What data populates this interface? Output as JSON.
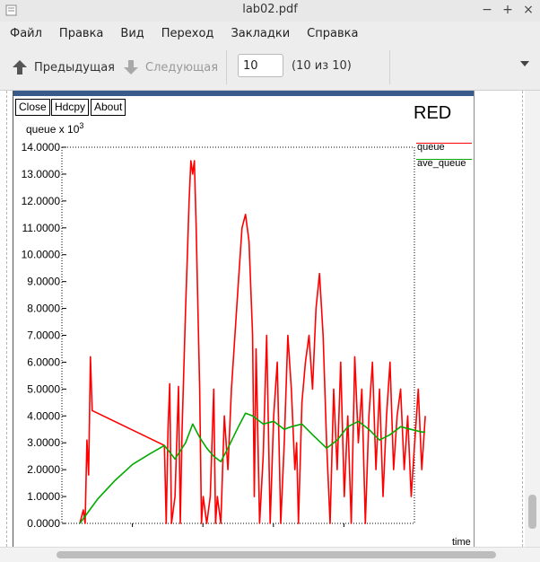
{
  "window": {
    "title": "lab02.pdf",
    "controls": [
      "−",
      "+",
      "×"
    ]
  },
  "menu": [
    "Файл",
    "Правка",
    "Вид",
    "Переход",
    "Закладки",
    "Справка"
  ],
  "toolbar": {
    "prev_label": "Предыдущая",
    "next_label": "Следующая",
    "page_value": "10",
    "page_count": "(10 из 10)"
  },
  "xgraph": {
    "buttons": [
      "Close",
      "Hdcpy",
      "About"
    ],
    "title": "RED",
    "ylabel_base": "queue x 10",
    "ylabel_exp": "3",
    "xlabel": "time",
    "legend": [
      "queue",
      "ave_queue"
    ],
    "colors": {
      "queue": "#ff0000",
      "ave_queue": "#00aa00"
    }
  },
  "chart_data": {
    "type": "line",
    "title": "RED",
    "ylabel": "queue x 10^3",
    "xlabel": "time",
    "ylim": [
      0,
      14
    ],
    "yticks": [
      "0.0000",
      "1.0000",
      "2.0000",
      "3.0000",
      "4.0000",
      "5.0000",
      "6.0000",
      "7.0000",
      "8.0000",
      "9.0000",
      "10.0000",
      "11.0000",
      "12.0000",
      "13.0000",
      "14.0000"
    ],
    "grid": false,
    "legend_position": "right",
    "series": [
      {
        "name": "queue",
        "points": [
          [
            0.0,
            0.0
          ],
          [
            0.01,
            0.5
          ],
          [
            0.015,
            0.0
          ],
          [
            0.02,
            3.1
          ],
          [
            0.025,
            1.8
          ],
          [
            0.03,
            6.2
          ],
          [
            0.035,
            4.2
          ],
          [
            0.24,
            2.9
          ],
          [
            0.245,
            0.0
          ],
          [
            0.25,
            3.5
          ],
          [
            0.255,
            5.2
          ],
          [
            0.26,
            0.0
          ],
          [
            0.27,
            1.0
          ],
          [
            0.28,
            5.1
          ],
          [
            0.285,
            0.0
          ],
          [
            0.29,
            3.5
          ],
          [
            0.3,
            8.0
          ],
          [
            0.305,
            10.0
          ],
          [
            0.31,
            12.0
          ],
          [
            0.315,
            13.5
          ],
          [
            0.32,
            13.0
          ],
          [
            0.325,
            13.5
          ],
          [
            0.33,
            11.0
          ],
          [
            0.34,
            5.0
          ],
          [
            0.345,
            0.0
          ],
          [
            0.35,
            1.0
          ],
          [
            0.36,
            0.0
          ],
          [
            0.37,
            1.0
          ],
          [
            0.38,
            5.0
          ],
          [
            0.385,
            0.0
          ],
          [
            0.39,
            1.0
          ],
          [
            0.4,
            0.0
          ],
          [
            0.41,
            4.0
          ],
          [
            0.42,
            2.0
          ],
          [
            0.43,
            5.0
          ],
          [
            0.44,
            7.0
          ],
          [
            0.45,
            9.0
          ],
          [
            0.46,
            11.0
          ],
          [
            0.47,
            11.5
          ],
          [
            0.48,
            10.5
          ],
          [
            0.49,
            7.0
          ],
          [
            0.495,
            1.0
          ],
          [
            0.5,
            6.5
          ],
          [
            0.51,
            0.0
          ],
          [
            0.52,
            2.5
          ],
          [
            0.53,
            7.0
          ],
          [
            0.54,
            0.0
          ],
          [
            0.55,
            4.0
          ],
          [
            0.56,
            6.0
          ],
          [
            0.57,
            0.0
          ],
          [
            0.58,
            3.0
          ],
          [
            0.59,
            7.0
          ],
          [
            0.6,
            5.0
          ],
          [
            0.61,
            2.0
          ],
          [
            0.615,
            3.0
          ],
          [
            0.62,
            0.0
          ],
          [
            0.63,
            4.5
          ],
          [
            0.64,
            6.0
          ],
          [
            0.65,
            7.0
          ],
          [
            0.66,
            5.0
          ],
          [
            0.67,
            8.0
          ],
          [
            0.68,
            9.3
          ],
          [
            0.69,
            7.0
          ],
          [
            0.7,
            3.0
          ],
          [
            0.71,
            0.0
          ],
          [
            0.72,
            5.0
          ],
          [
            0.73,
            2.0
          ],
          [
            0.74,
            6.0
          ],
          [
            0.75,
            1.0
          ],
          [
            0.76,
            4.0
          ],
          [
            0.77,
            0.0
          ],
          [
            0.78,
            6.2
          ],
          [
            0.79,
            3.0
          ],
          [
            0.8,
            5.0
          ],
          [
            0.81,
            0.0
          ],
          [
            0.82,
            4.0
          ],
          [
            0.83,
            6.0
          ],
          [
            0.84,
            2.0
          ],
          [
            0.85,
            5.0
          ],
          [
            0.86,
            1.0
          ],
          [
            0.87,
            4.0
          ],
          [
            0.88,
            6.0
          ],
          [
            0.89,
            2.0
          ],
          [
            0.9,
            4.0
          ],
          [
            0.91,
            5.0
          ],
          [
            0.92,
            2.0
          ],
          [
            0.93,
            4.0
          ],
          [
            0.94,
            1.0
          ],
          [
            0.95,
            3.0
          ],
          [
            0.96,
            5.0
          ],
          [
            0.97,
            2.0
          ],
          [
            0.98,
            4.0
          ]
        ]
      },
      {
        "name": "ave_queue",
        "points": [
          [
            0.0,
            0.0
          ],
          [
            0.05,
            0.9
          ],
          [
            0.1,
            1.6
          ],
          [
            0.15,
            2.2
          ],
          [
            0.2,
            2.6
          ],
          [
            0.24,
            2.9
          ],
          [
            0.27,
            2.4
          ],
          [
            0.3,
            3.0
          ],
          [
            0.32,
            3.7
          ],
          [
            0.34,
            3.2
          ],
          [
            0.36,
            2.8
          ],
          [
            0.38,
            2.5
          ],
          [
            0.4,
            2.3
          ],
          [
            0.42,
            2.8
          ],
          [
            0.45,
            3.6
          ],
          [
            0.47,
            4.1
          ],
          [
            0.49,
            4.0
          ],
          [
            0.52,
            3.7
          ],
          [
            0.55,
            3.8
          ],
          [
            0.58,
            3.5
          ],
          [
            0.6,
            3.6
          ],
          [
            0.63,
            3.7
          ],
          [
            0.66,
            3.3
          ],
          [
            0.7,
            2.8
          ],
          [
            0.73,
            3.1
          ],
          [
            0.76,
            3.6
          ],
          [
            0.79,
            3.8
          ],
          [
            0.82,
            3.5
          ],
          [
            0.85,
            3.1
          ],
          [
            0.88,
            3.3
          ],
          [
            0.91,
            3.6
          ],
          [
            0.94,
            3.5
          ],
          [
            0.97,
            3.4
          ],
          [
            0.98,
            3.4
          ]
        ]
      }
    ]
  }
}
